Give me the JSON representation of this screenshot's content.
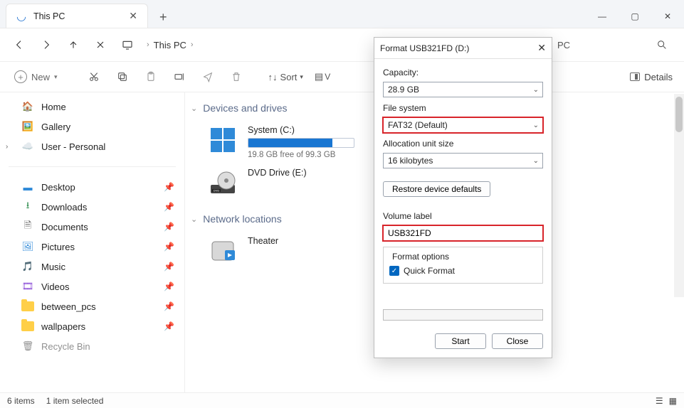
{
  "window": {
    "tab_title": "This PC",
    "new_button": "New",
    "sort_label": "Sort",
    "details_label": "Details"
  },
  "nav": {
    "breadcrumb_root": "This PC",
    "breadcrumb_after": "PC"
  },
  "sidebar": {
    "home": "Home",
    "gallery": "Gallery",
    "user": "User - Personal",
    "desktop": "Desktop",
    "downloads": "Downloads",
    "documents": "Documents",
    "pictures": "Pictures",
    "music": "Music",
    "videos": "Videos",
    "between": "between_pcs",
    "wallpapers": "wallpapers",
    "recycle": "Recycle Bin"
  },
  "content": {
    "group_devices": "Devices and drives",
    "drive_c_label": "System (C:)",
    "drive_c_sub": "19.8 GB free of 99.3 GB",
    "drive_c_fill_pct": 80,
    "dvd_label": "DVD Drive (E:)",
    "group_network": "Network locations",
    "theater": "Theater"
  },
  "dialog": {
    "title": "Format USB321FD (D:)",
    "capacity_label": "Capacity:",
    "capacity_value": "28.9 GB",
    "fs_label": "File system",
    "fs_value": "FAT32 (Default)",
    "aus_label": "Allocation unit size",
    "aus_value": "16 kilobytes",
    "restore_btn": "Restore device defaults",
    "vol_label": "Volume label",
    "vol_value": "USB321FD",
    "options_legend": "Format options",
    "quick_format": "Quick Format",
    "start_btn": "Start",
    "close_btn": "Close"
  },
  "status": {
    "items": "6 items",
    "selected": "1 item selected"
  }
}
